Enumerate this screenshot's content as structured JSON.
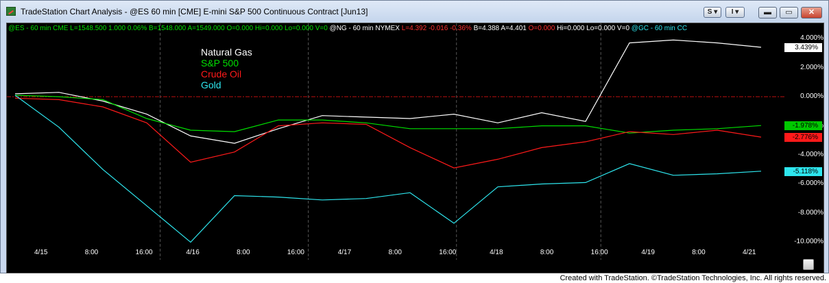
{
  "window": {
    "title": "TradeStation Chart Analysis - @ES 60 min [CME] E-mini S&P 500 Continuous Contract [Jun13]",
    "buttons": {
      "style_label": "S",
      "insert_label": "I",
      "minimize": "minimize",
      "maximize": "maximize",
      "close": "close"
    }
  },
  "status": {
    "es": "@ES - 60 min  CME  L=1548.500  1.000  0.06%  B=1548.000  A=1549.000  O=0.000  Hi=0.000  Lo=0.000  V=0",
    "ng_name": "@NG - 60 min  NYMEX",
    "ng_change": "L=4.392  -0.016  -0.36%",
    "ng_rest": "B=4.388  A=4.401",
    "ng_open": "O=0.000",
    "ng_tail": "Hi=0.000  Lo=0.000  V=0",
    "gc": "@GC - 60 min  CC"
  },
  "legend": {
    "natural_gas": "Natural Gas",
    "sp500": "S&P 500",
    "crude_oil": "Crude Oil",
    "gold": "Gold"
  },
  "colors": {
    "natural_gas": "#ffffff",
    "sp500": "#00e000",
    "crude_oil": "#ff1a1a",
    "gold": "#2ee6ee",
    "zero_line": "#c01010",
    "grid": "#555555"
  },
  "chart_data": {
    "type": "line",
    "x": [
      "4/15",
      "8:00",
      "16:00",
      "4/16",
      "8:00",
      "16:00",
      "4/17",
      "8:00",
      "16:00",
      "4/18",
      "8:00",
      "16:00",
      "4/19",
      "8:00",
      "4/21"
    ],
    "ylabel": "",
    "y_ticks": [
      "4.000%",
      "2.000%",
      "0.000%",
      "-2.000%",
      "-4.000%",
      "-6.000%",
      "-8.000%",
      "-10.000%"
    ],
    "ylim": [
      -10.5,
      4.2
    ],
    "series": [
      {
        "name": "Natural Gas",
        "last_label": "3.439%",
        "values": [
          0.2,
          0.3,
          -0.3,
          -1.2,
          -2.7,
          -3.2,
          -2.2,
          -1.3,
          -1.4,
          -1.5,
          -1.2,
          -1.8,
          -1.1,
          -1.7,
          3.7,
          3.9,
          3.7,
          3.4
        ]
      },
      {
        "name": "S&P 500",
        "last_label": "-1.978%",
        "values": [
          0.1,
          0.0,
          -0.2,
          -1.5,
          -2.3,
          -2.4,
          -1.6,
          -1.6,
          -1.8,
          -2.2,
          -2.2,
          -2.2,
          -2.0,
          -2.0,
          -2.5,
          -2.3,
          -2.2,
          -1.98
        ]
      },
      {
        "name": "Crude Oil",
        "last_label": "-2.776%",
        "values": [
          -0.1,
          -0.2,
          -0.7,
          -1.8,
          -4.5,
          -3.8,
          -2.0,
          -1.8,
          -1.9,
          -3.5,
          -4.9,
          -4.3,
          -3.5,
          -3.1,
          -2.4,
          -2.6,
          -2.3,
          -2.78
        ]
      },
      {
        "name": "Gold",
        "last_label": "-5.118%",
        "values": [
          0.1,
          -2.1,
          -5.0,
          -7.5,
          -10.0,
          -6.8,
          -6.9,
          -7.1,
          -7.0,
          -6.6,
          -8.7,
          -6.2,
          -6.0,
          -5.9,
          -4.6,
          -5.4,
          -5.3,
          -5.12
        ]
      }
    ]
  },
  "footer": {
    "credit": "Created with TradeStation. ©TradeStation Technologies, Inc. All rights reserved."
  }
}
